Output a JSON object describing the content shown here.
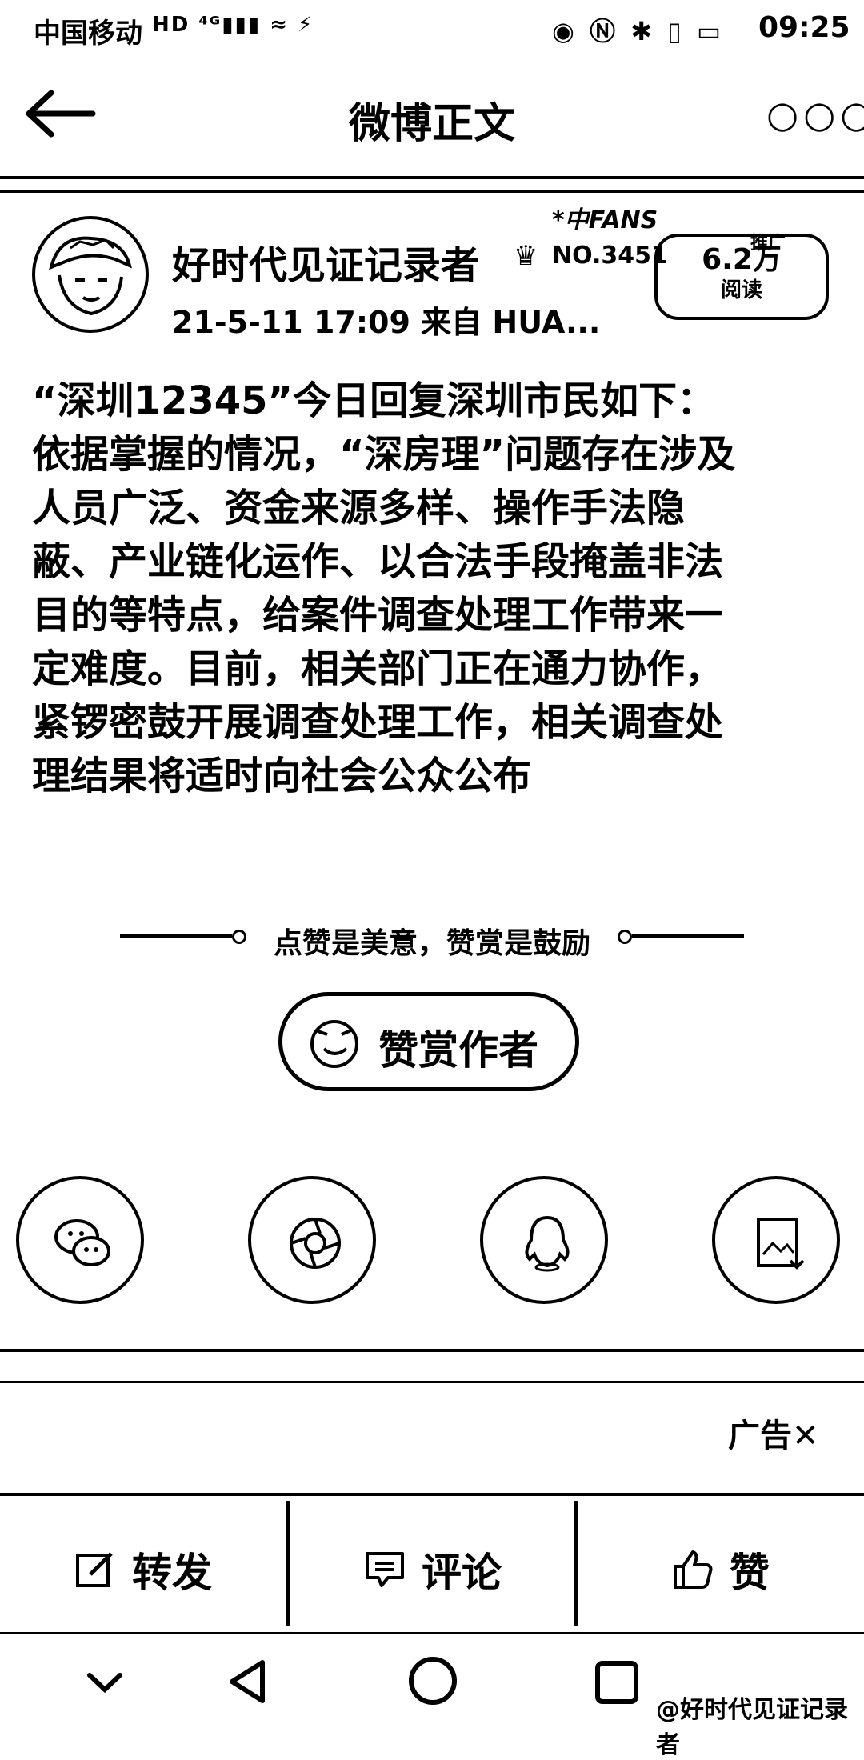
{
  "status_bar": {
    "carrier": "中国移动",
    "signal_icons": "HD ⁴ᴳ▮▮▮ ≈ ⚡",
    "right_icons": "◉ Ⓝ ✱ ▯ ▭",
    "time": "09:25"
  },
  "nav": {
    "title": "微博正文",
    "more": "○○○"
  },
  "author": {
    "name": "好时代见证记录者",
    "badge_no": "NO.3451",
    "fans_deco": "*中FANS",
    "time_source": "21-5-11 17:09  来自 HUA...",
    "read_count": "6.2万",
    "read_label": "阅读",
    "promo_label": "推广"
  },
  "post": {
    "lines": [
      "“深圳12345”今日回复深圳市民如下：",
      "依据掌握的情况，“深房理”问题存在涉及",
      "人员广泛、资金来源多样、操作手法隐",
      "蔽、产业链化运作、以合法手段掩盖非法",
      "目的等特点，给案件调查处理工作带来一",
      "定难度。目前，相关部门正在通力协作，",
      "紧锣密鼓开展调查处理工作，相关调查处",
      "理结果将适时向社会公众公布"
    ]
  },
  "reward": {
    "tip": "点赞是美意，赞赏是鼓励",
    "button": "赞赏作者"
  },
  "ad": {
    "label": "广告✕"
  },
  "actions": {
    "repost": "转发",
    "comment": "评论",
    "like": "赞"
  },
  "watermark": "@好时代见证记录者",
  "icons": {
    "back": "back-arrow-icon",
    "share1": "wechat-icon",
    "share2": "moments-icon",
    "share3": "qq-icon",
    "share4": "save-image-icon"
  }
}
